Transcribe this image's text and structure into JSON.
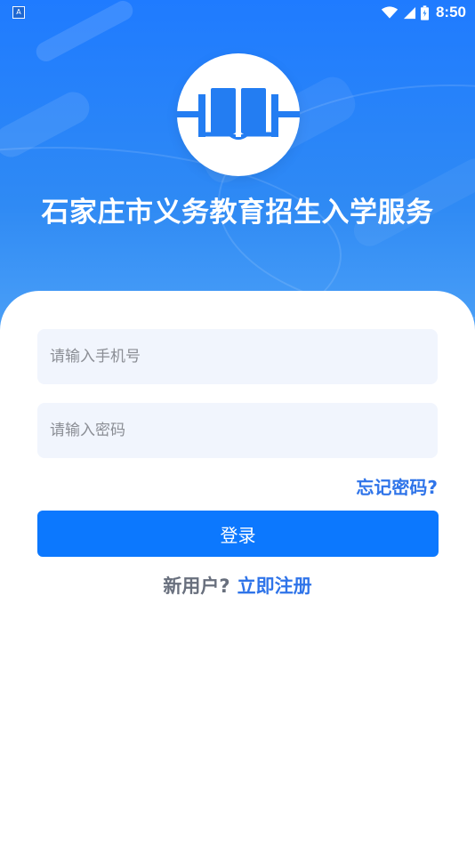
{
  "status_bar": {
    "notification_badge": "A",
    "wifi_icon": "wifi-icon",
    "signal_icon": "signal-icon",
    "battery_icon": "battery-icon",
    "time": "8:50"
  },
  "app": {
    "logo_icon": "open-book-icon",
    "title": "石家庄市义务教育招生入学服务"
  },
  "login_form": {
    "phone_placeholder": "请输入手机号",
    "password_placeholder": "请输入密码",
    "forgot_password": "忘记密码?",
    "login_button": "登录",
    "new_user_text": "新用户?",
    "register_link": "立即注册"
  },
  "colors": {
    "header_blue": "#1f7bff",
    "primary_button": "#0c78fe",
    "link_blue": "#2f74e9",
    "input_background": "#f1f5fd",
    "placeholder_gray": "#8b8e95"
  }
}
